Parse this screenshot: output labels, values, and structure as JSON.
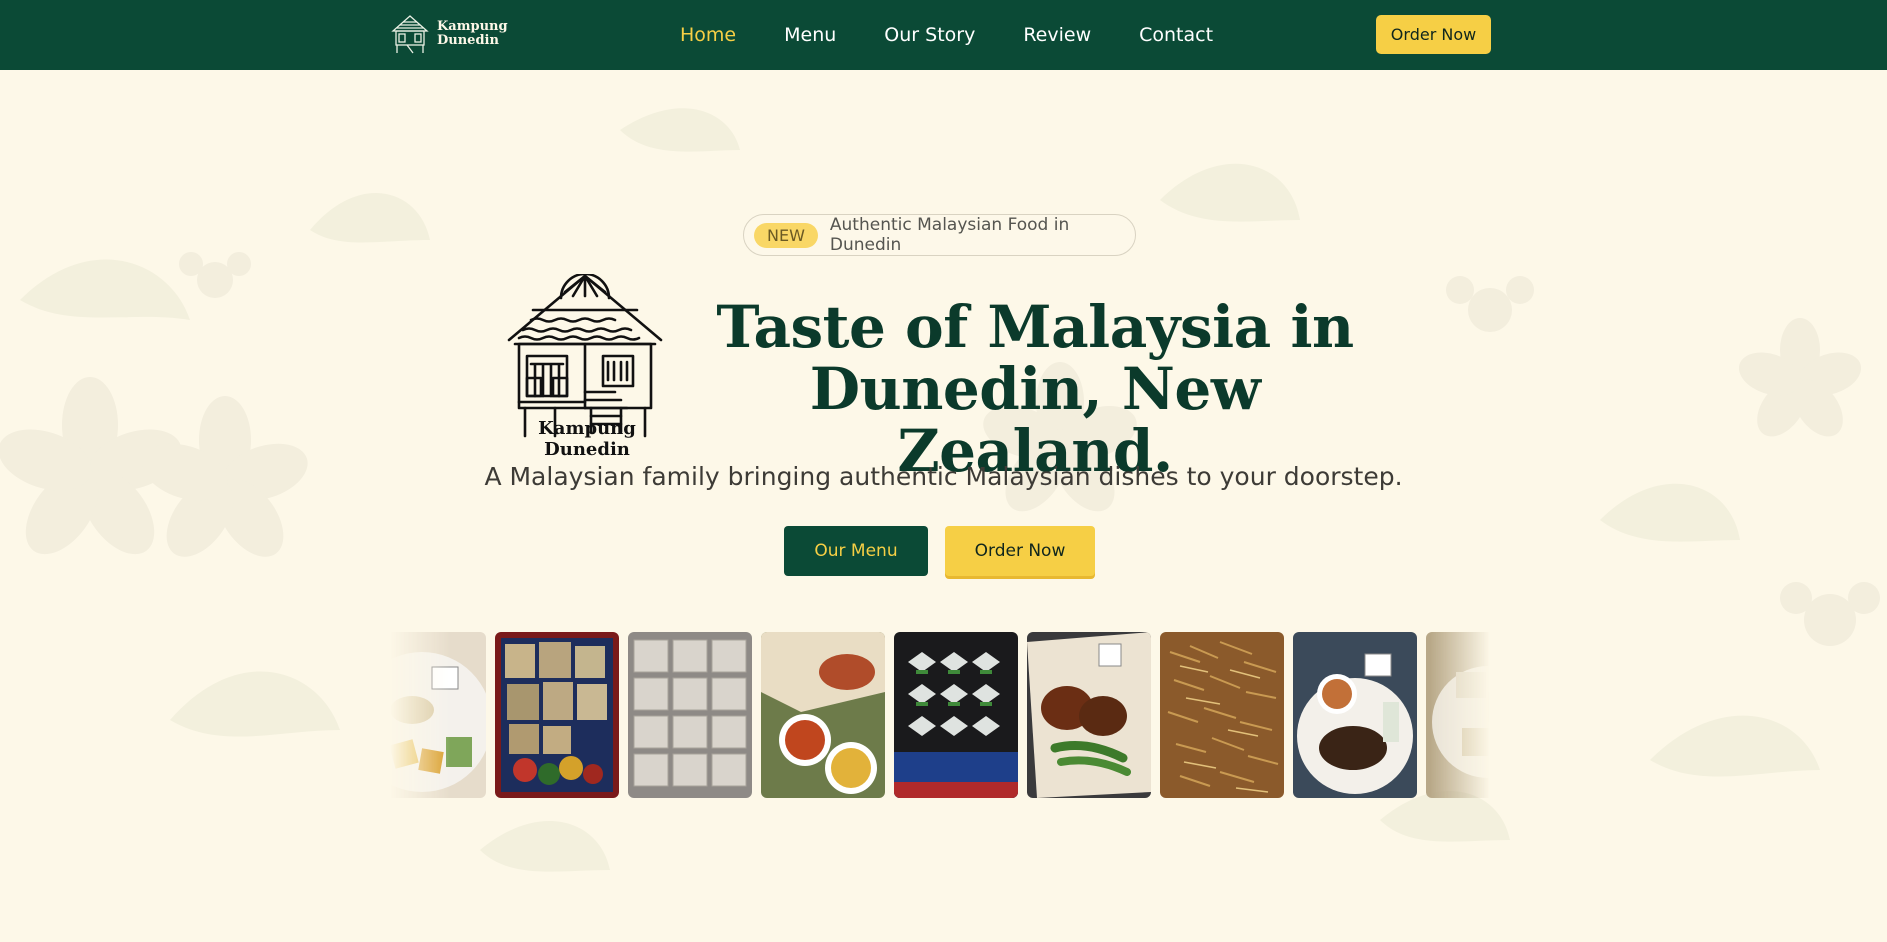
{
  "brand": {
    "name_line1": "Kampung",
    "name_line2": "Dunedin",
    "logo_caption": "Kampung Dunedin"
  },
  "nav": {
    "links": [
      "Home",
      "Menu",
      "Our Story",
      "Review",
      "Contact"
    ],
    "active": "Home",
    "order_label": "Order Now"
  },
  "hero": {
    "badge_pill": "NEW",
    "badge_text": "Authentic Malaysian Food in Dunedin",
    "title_line1": "Taste of Malaysia in",
    "title_line2": "Dunedin, New Zealand.",
    "subtitle": "A Malaysian family bringing authentic Malaysian dishes to your doorstep.",
    "btn_menu": "Our Menu",
    "btn_order": "Order Now"
  },
  "gallery": {
    "photos": [
      "plate-of-kuih-and-sauce",
      "packed-bags-on-batik-cloth",
      "tray-of-packaged-kuih",
      "nasi-lemak-with-sambal-bowls",
      "wrapped-snacks-on-black-tray",
      "rendang-with-okra-on-paper",
      "fried-anchovies-pile",
      "beef-rendang-with-peanut-sauce",
      "plate-of-packaged-food"
    ]
  },
  "colors": {
    "primary": "#0b4a36",
    "accent": "#f6cf45",
    "background": "#fdf8e8",
    "title": "#0b3a2b"
  }
}
